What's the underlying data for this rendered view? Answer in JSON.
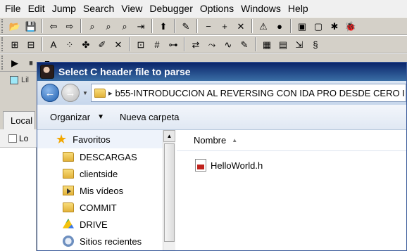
{
  "ida": {
    "menu": [
      "File",
      "Edit",
      "Jump",
      "Search",
      "View",
      "Debugger",
      "Options",
      "Windows",
      "Help"
    ],
    "toolbar_row1": [
      {
        "icon": "open-folder-icon",
        "glyph": "📂"
      },
      {
        "icon": "save-icon",
        "glyph": "💾"
      },
      {
        "icon": "back-arrow-icon",
        "glyph": "⇦"
      },
      {
        "icon": "forward-arrow-icon",
        "glyph": "⇨"
      },
      {
        "icon": "binoculars-icon",
        "glyph": "⌕"
      },
      {
        "icon": "binoculars-text-icon",
        "glyph": "⌕"
      },
      {
        "icon": "binoculars-hex-icon",
        "glyph": "⌕"
      },
      {
        "icon": "jump-icon",
        "glyph": "⇥"
      },
      {
        "icon": "up-arrow-icon",
        "glyph": "⬆"
      },
      {
        "icon": "analyze-icon",
        "glyph": "✎"
      },
      {
        "icon": "minus-icon",
        "glyph": "−"
      },
      {
        "icon": "plus-icon",
        "glyph": "+"
      },
      {
        "icon": "cross-icon",
        "glyph": "✕"
      },
      {
        "icon": "warning-icon",
        "glyph": "⚠"
      },
      {
        "icon": "record-icon",
        "glyph": "●"
      },
      {
        "icon": "window-icon",
        "glyph": "▣"
      },
      {
        "icon": "window-alt-icon",
        "glyph": "▢"
      },
      {
        "icon": "debug-icon",
        "glyph": "✱"
      },
      {
        "icon": "bug-icon",
        "glyph": "🐞"
      }
    ],
    "toolbar_row2": [
      {
        "icon": "code-icon",
        "glyph": "⊞"
      },
      {
        "icon": "data-icon",
        "glyph": "⊟"
      },
      {
        "icon": "string-icon",
        "glyph": "A"
      },
      {
        "icon": "array-icon",
        "glyph": "⁘"
      },
      {
        "icon": "struct-icon",
        "glyph": "✤"
      },
      {
        "icon": "edit-icon",
        "glyph": "✐"
      },
      {
        "icon": "delete-icon",
        "glyph": "✕"
      },
      {
        "icon": "offset-icon",
        "glyph": "⊡"
      },
      {
        "icon": "number-icon",
        "glyph": "#"
      },
      {
        "icon": "graph-icon",
        "glyph": "⊶"
      },
      {
        "icon": "xref-icon",
        "glyph": "⇄"
      },
      {
        "icon": "flow-icon",
        "glyph": "⤳"
      },
      {
        "icon": "chart-icon",
        "glyph": "∿"
      },
      {
        "icon": "note-icon",
        "glyph": "✎"
      },
      {
        "icon": "calc-icon",
        "glyph": "▦"
      },
      {
        "icon": "pages-icon",
        "glyph": "▤"
      },
      {
        "icon": "export-icon",
        "glyph": "⇲"
      },
      {
        "icon": "script-icon",
        "glyph": "§"
      }
    ],
    "toolbar_row3": [
      {
        "icon": "run-icon",
        "glyph": "▶"
      },
      {
        "icon": "pause-icon",
        "glyph": "⏸"
      },
      {
        "icon": "stop-icon",
        "glyph": "■"
      }
    ],
    "lib_label": "Lil",
    "tab_label": "Local",
    "subpanel_label": "Lo"
  },
  "dialog": {
    "title": "Select C header file to parse",
    "address_path": "b55-INTRODUCCION AL REVERSING CON IDA PRO DESDE CERO I",
    "command_bar": {
      "organize": "Organizar",
      "new_folder": "Nueva carpeta"
    },
    "nav_pane": {
      "favorites": "Favoritos",
      "items": [
        {
          "label": "DESCARGAS",
          "icon": "folder-icon"
        },
        {
          "label": "clientside",
          "icon": "folder-icon"
        },
        {
          "label": "Mis vídeos",
          "icon": "video-folder-icon"
        },
        {
          "label": "COMMIT",
          "icon": "folder-icon"
        },
        {
          "label": "DRIVE",
          "icon": "drive-icon"
        },
        {
          "label": "Sitios recientes",
          "icon": "recent-places-icon"
        }
      ]
    },
    "file_list": {
      "column_name": "Nombre",
      "files": [
        {
          "name": "HelloWorld.h",
          "icon": "header-file-icon"
        }
      ]
    }
  }
}
